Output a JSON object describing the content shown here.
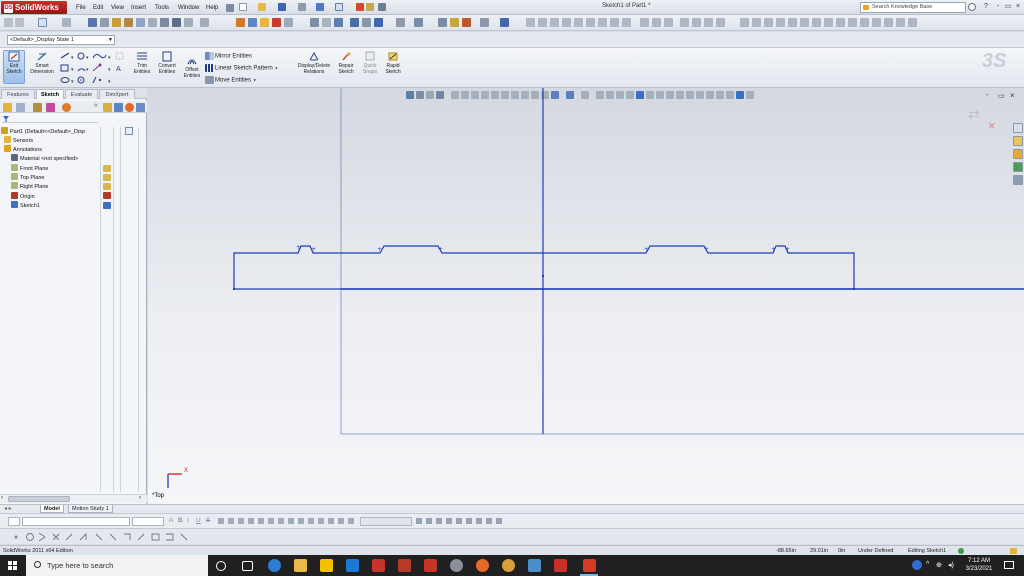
{
  "app": {
    "name": "SolidWorks",
    "menus": [
      "File",
      "Edit",
      "View",
      "Insert",
      "Tools",
      "Window",
      "Help"
    ],
    "doc_title": "Sketch1 of Part1 *",
    "search_placeholder": "Search Knowledge Base",
    "window_controls": [
      "?",
      "-",
      "▭",
      "×"
    ]
  },
  "config": {
    "display_state": "<Default>_Display State 1"
  },
  "command_manager": {
    "exit_sketch": [
      "Exit",
      "Sketch"
    ],
    "smart_dimension": [
      "Smart",
      "Dimension"
    ],
    "trim": [
      "Trim",
      "Entities"
    ],
    "convert": [
      "Convert",
      "Entities"
    ],
    "offset": [
      "Offset",
      "Entities"
    ],
    "mirror": "Mirror Entities",
    "linear_pattern": "Linear Sketch Pattern",
    "move": "Move Entities",
    "display_delete": [
      "Display/Delete",
      "Relations"
    ],
    "repair": [
      "Repair",
      "Sketch"
    ],
    "quick_snaps": [
      "Quick",
      "Snaps"
    ],
    "rapid_sketch": [
      "Rapid",
      "Sketch"
    ]
  },
  "panel": {
    "tabs": [
      "Features",
      "Sketch",
      "Evaluate",
      "DimXpert"
    ],
    "active_tab": "Sketch",
    "tree": [
      {
        "label": "Part1  (Default<<Default>_Disp",
        "icon": "part-icon",
        "color": "#c9a227"
      },
      {
        "label": "Sensors",
        "icon": "sensors-icon",
        "color": "#e6b33a"
      },
      {
        "label": "Annotations",
        "icon": "annotations-icon",
        "color": "#e0a020"
      },
      {
        "label": "Material <not specified>",
        "icon": "material-icon",
        "color": "#5a6b7d"
      },
      {
        "label": "Front Plane",
        "icon": "plane-icon",
        "color": "#a9b87a"
      },
      {
        "label": "Top Plane",
        "icon": "plane-icon",
        "color": "#a9b87a"
      },
      {
        "label": "Right Plane",
        "icon": "plane-icon",
        "color": "#a9b87a"
      },
      {
        "label": "Origin",
        "icon": "origin-icon",
        "color": "#b33a2a"
      },
      {
        "label": "Sketch1",
        "icon": "sketch-icon",
        "color": "#3a6fc4"
      }
    ]
  },
  "canvas": {
    "view_orientation": "*Top",
    "triad": {
      "x_label": "X"
    },
    "sketch_color": "#1f3fb4",
    "line_color": "#0d2b9c"
  },
  "bottom_tabs": [
    "Model",
    "Motion Study 1"
  ],
  "active_bottom_tab": "Model",
  "format_bar": [
    "A",
    "B",
    "I",
    "U",
    "S"
  ],
  "status": {
    "edition": "SolidWorks 2011 x64 Edition",
    "x": "-88.65in",
    "y": "29.01in",
    "z": "0in",
    "definition": "Under Defined",
    "mode": "Editing Sketch1"
  },
  "taskbar": {
    "search_placeholder": "Type here to search",
    "time": "7:12 AM",
    "date": "3/23/2021"
  }
}
